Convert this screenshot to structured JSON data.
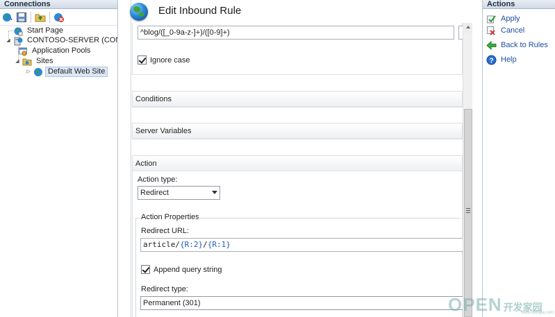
{
  "connections": {
    "header": "Connections",
    "tree": [
      {
        "label": "Start Page",
        "icon": "start-page-icon"
      },
      {
        "label": "CONTOSO-SERVER (CONTOS",
        "icon": "server-icon"
      },
      {
        "label": "Application Pools",
        "icon": "app-pools-icon"
      },
      {
        "label": "Sites",
        "icon": "sites-folder-icon"
      },
      {
        "label": "Default Web Site",
        "icon": "globe-icon",
        "selected": true
      }
    ]
  },
  "dialog": {
    "title": "Edit Inbound Rule",
    "pattern_value": "^blog/([_0-9a-z-]+)/([0-9]+)",
    "ignore_case_label": "Ignore case",
    "sections": {
      "conditions": "Conditions",
      "server_variables": "Server Variables",
      "action": "Action"
    },
    "action_type_label": "Action type:",
    "action_type_value": "Redirect",
    "action_properties_label": "Action Properties",
    "redirect_url_label": "Redirect URL:",
    "redirect_url_parts": {
      "p1": "article/",
      "p2": "{R:2}",
      "p3": "/",
      "p4": "{R:1}"
    },
    "append_query_label": "Append query string",
    "redirect_type_label": "Redirect type:",
    "redirect_type_value": "Permanent (301)"
  },
  "actions": {
    "header": "Actions",
    "items": [
      {
        "label": "Apply",
        "icon": "apply-icon"
      },
      {
        "label": "Cancel",
        "icon": "cancel-icon"
      },
      {
        "label": "Back to Rules",
        "icon": "back-arrow-icon"
      },
      {
        "label": "Help",
        "icon": "help-icon"
      }
    ]
  },
  "watermark": {
    "main": "OPEN",
    "sub": "开发家园",
    "url": "www.kaifajia.com"
  },
  "colors": {
    "link": "#1b4e9b",
    "header_bg": "#cfd9e6",
    "selected_bg": "#dbe6f4"
  }
}
